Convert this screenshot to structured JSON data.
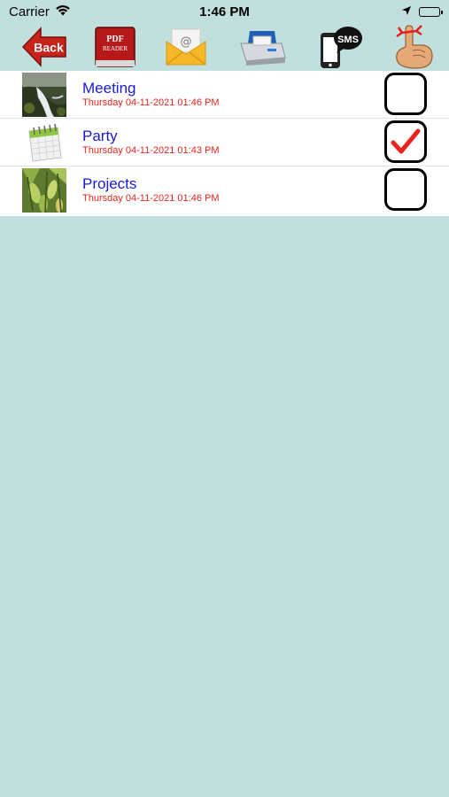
{
  "status_bar": {
    "carrier": "Carrier",
    "time": "1:46 PM"
  },
  "toolbar": {
    "back_label": "Back",
    "pdf_line1": "PDF",
    "pdf_line2": "READER",
    "sms_label": "SMS"
  },
  "items": [
    {
      "title": "Meeting",
      "date": "Thursday 04-11-2021 01:46 PM",
      "checked": false,
      "thumb": "waterfall-photo"
    },
    {
      "title": "Party",
      "date": "Thursday 04-11-2021 01:43 PM",
      "checked": true,
      "thumb": "calendar-icon"
    },
    {
      "title": "Projects",
      "date": "Thursday 04-11-2021 01:46 PM",
      "checked": false,
      "thumb": "plant-photo"
    }
  ],
  "colors": {
    "background": "#c1dfdd",
    "title": "#1a1adb",
    "date": "#e8241c",
    "check": "#e8241c"
  }
}
